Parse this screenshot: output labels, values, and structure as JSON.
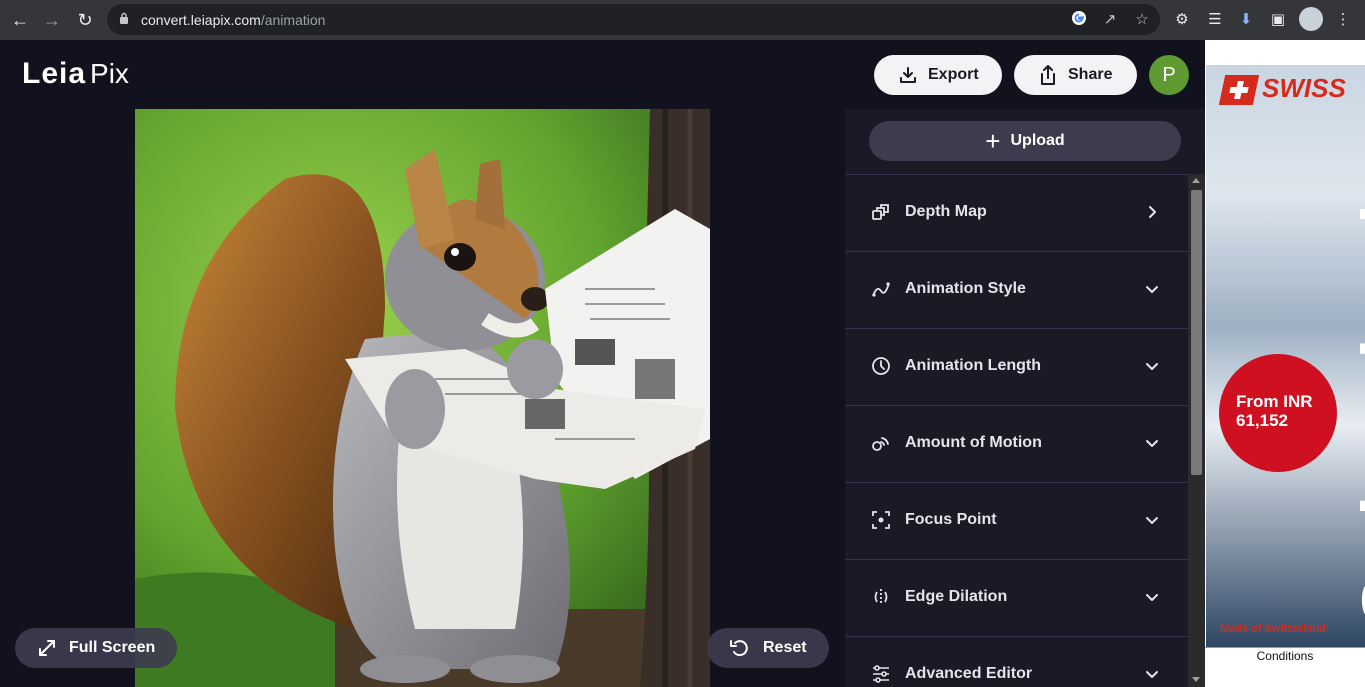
{
  "browser": {
    "url_domain": "convert.leiapix.com",
    "url_path": "/animation",
    "icons": [
      "back-icon",
      "forward-icon",
      "reload-icon",
      "lock-icon",
      "google-icon",
      "share-page-icon",
      "star-icon",
      "extensions-icon",
      "reading-list-icon",
      "download-icon",
      "sidebar-icon",
      "profile-icon",
      "menu-icon"
    ]
  },
  "app": {
    "logo_main": "Leia",
    "logo_sub": "Pix",
    "export_label": "Export",
    "share_label": "Share",
    "avatar_initial": "P",
    "avatar_color": "#5f9a32"
  },
  "viewer": {
    "fullscreen_label": "Full Screen",
    "reset_label": "Reset"
  },
  "panel": {
    "upload_label": "Upload",
    "items": [
      {
        "label": "Depth Map",
        "icon": "depth-map-icon",
        "chevron": "right"
      },
      {
        "label": "Animation Style",
        "icon": "animation-style-icon",
        "chevron": "down"
      },
      {
        "label": "Animation Length",
        "icon": "clock-icon",
        "chevron": "down"
      },
      {
        "label": "Amount of Motion",
        "icon": "motion-icon",
        "chevron": "down"
      },
      {
        "label": "Focus Point",
        "icon": "focus-point-icon",
        "chevron": "down"
      },
      {
        "label": "Edge Dilation",
        "icon": "edge-dilation-icon",
        "chevron": "down"
      },
      {
        "label": "Advanced Editor",
        "icon": "sliders-icon",
        "chevron": "down"
      }
    ]
  },
  "ad": {
    "brand": "SWISS",
    "vertical_text": "Switzerland",
    "offer_line1": "From INR",
    "offer_line2": "61,152",
    "made_text": "Made of Switzerland",
    "conditions": "Conditions",
    "brand_color": "#d52b1e"
  }
}
